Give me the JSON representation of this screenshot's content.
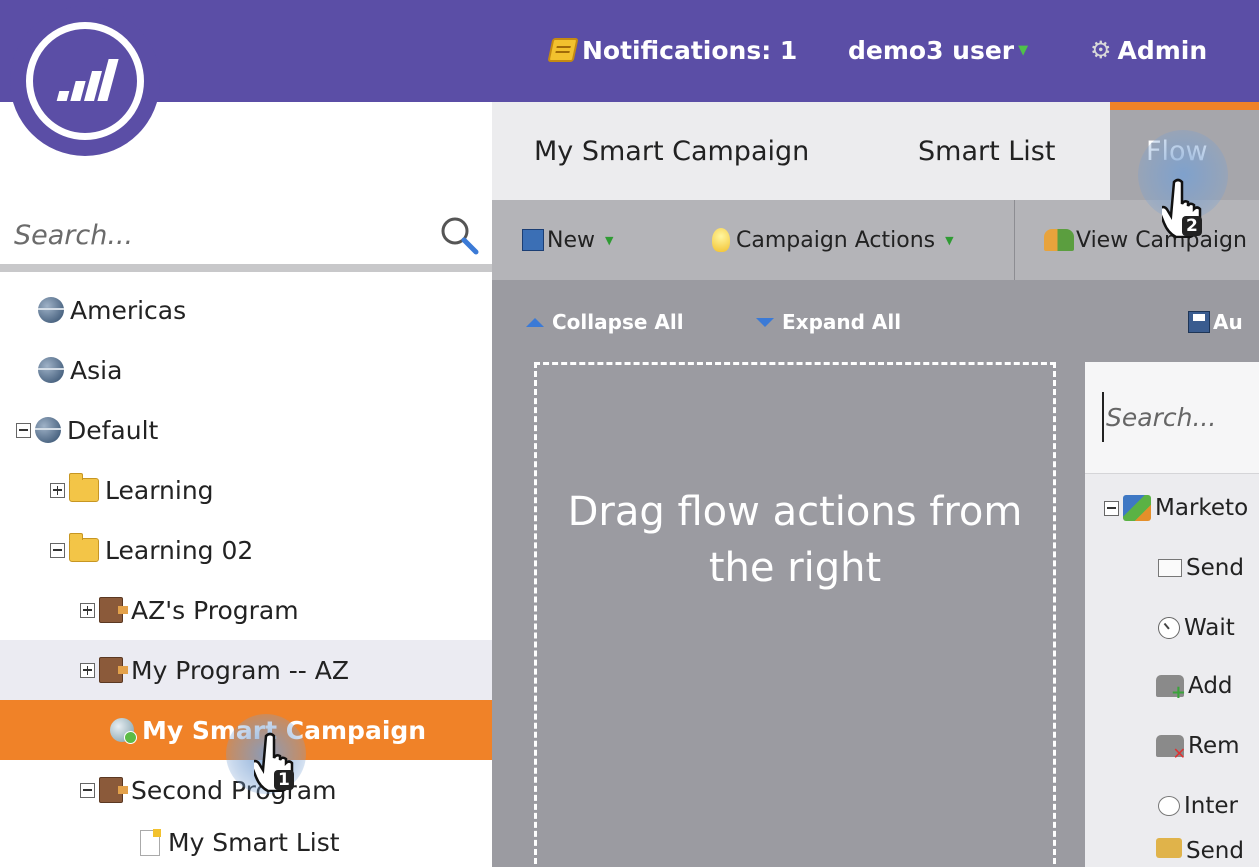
{
  "topbar": {
    "notifications": "Notifications: 1",
    "user": "demo3 user",
    "admin": "Admin"
  },
  "tabs": [
    {
      "label": "My Smart Campaign"
    },
    {
      "label": "Smart List"
    },
    {
      "label": "Flow"
    }
  ],
  "left_search": {
    "placeholder": "Search..."
  },
  "tree": [
    {
      "label": "Americas"
    },
    {
      "label": "Asia"
    },
    {
      "label": "Default"
    },
    {
      "label": "Learning"
    },
    {
      "label": "Learning 02"
    },
    {
      "label": "AZ's Program"
    },
    {
      "label": "My Program -- AZ"
    },
    {
      "label": "My Smart Campaign"
    },
    {
      "label": "Second Program"
    },
    {
      "label": "My Smart List"
    }
  ],
  "toolbar": {
    "new": "New",
    "campaign_actions": "Campaign Actions",
    "view_campaign": "View Campaign"
  },
  "canvas": {
    "collapse_all": "Collapse All",
    "expand_all": "Expand All",
    "autosave": "Au",
    "drop_text": "Drag flow actions from the right"
  },
  "right_panel": {
    "search_placeholder": "Search...",
    "items": [
      {
        "label": "Marketo"
      },
      {
        "label": "Send"
      },
      {
        "label": "Wait"
      },
      {
        "label": "Add"
      },
      {
        "label": "Rem"
      },
      {
        "label": "Inter"
      },
      {
        "label": "Send"
      }
    ]
  },
  "cursors": [
    {
      "badge": "1"
    },
    {
      "badge": "2"
    }
  ],
  "colors": {
    "brand": "#5b4ea6",
    "accent": "#f08228"
  }
}
